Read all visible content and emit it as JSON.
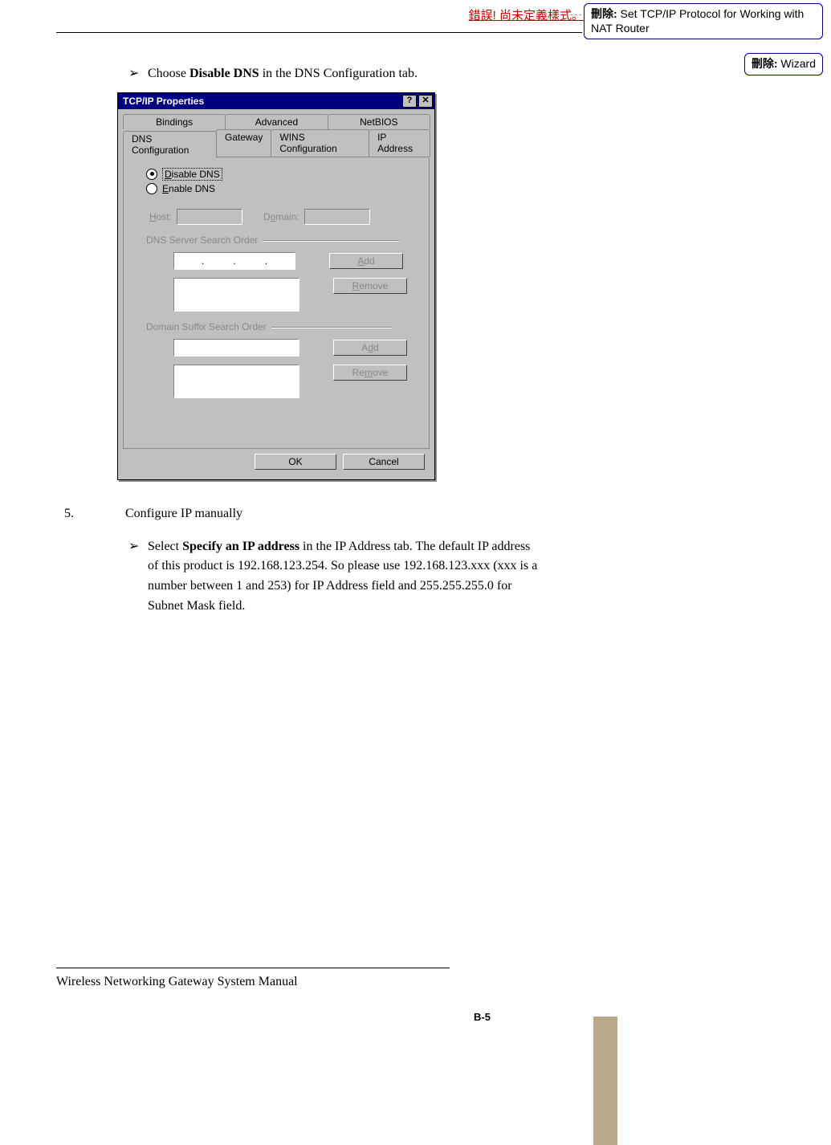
{
  "header": {
    "error_text": "錯誤! 尚未定義樣式。"
  },
  "comments": [
    {
      "label": "刪除:",
      "text": " Set TCP/IP Protocol for Working with NAT Router"
    },
    {
      "label": "刪除:",
      "text": " Wizard"
    }
  ],
  "step4": {
    "bullet_glyph": "➢",
    "text_pre": "Choose ",
    "bold": "Disable DNS",
    "text_post": " in the DNS Configuration tab."
  },
  "dialog": {
    "title": "TCP/IP Properties",
    "help_btn": "?",
    "close_btn": "✕",
    "tabs_top": [
      "Bindings",
      "Advanced",
      "NetBIOS"
    ],
    "tabs_bottom": [
      "DNS Configuration",
      "Gateway",
      "WINS Configuration",
      "IP Address"
    ],
    "radio_disable": "Disable DNS",
    "radio_enable": "Enable DNS",
    "host_label": "Host:",
    "domain_label": "Domain:",
    "group1": "DNS Server Search Order",
    "group2": "Domain Suffix Search Order",
    "add_btn": "Add",
    "remove_btn": "Remove",
    "ok_btn": "OK",
    "cancel_btn": "Cancel"
  },
  "step5": {
    "num": "5.",
    "title": "Configure IP manually",
    "bullet_glyph": "➢",
    "text_pre": "Select ",
    "bold": "Specify an IP address",
    "text_post": " in the IP Address tab. The default IP address of this product is 192.168.123.254. So please use 192.168.123.xxx (xxx is a number between 1 and 253) for IP Address field and 255.255.255.0 for Subnet Mask field."
  },
  "footer": {
    "manual_title": "Wireless Networking Gateway System Manual",
    "page_num": "B-5"
  }
}
